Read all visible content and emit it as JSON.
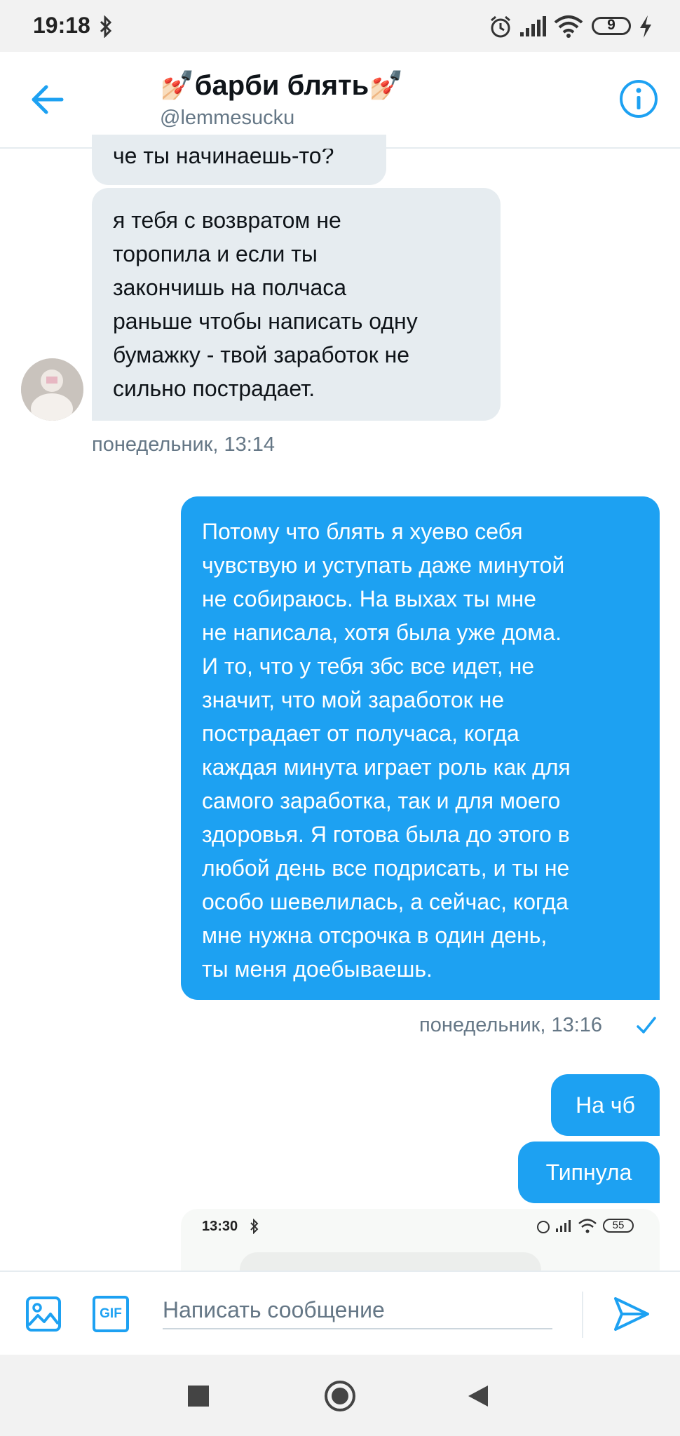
{
  "status_bar": {
    "time": "19:18",
    "battery": "9"
  },
  "header": {
    "title": "💅🏻барби блять💅🏻",
    "handle": "@lemmesucku"
  },
  "messages": [
    {
      "direction": "in",
      "text": "че ты начинаешь-то?"
    },
    {
      "direction": "in",
      "lines": [
        "я тебя с возвратом не",
        "торопила и если ты",
        "закончишь на полчаса",
        "раньше чтобы написать одну",
        "бумажку - твой заработок не",
        "сильно пострадает."
      ],
      "timestamp": "понедельник, 13:14"
    },
    {
      "direction": "out",
      "lines": [
        "Потому что блять я хуево себя",
        "чувствую и уступать даже минутой",
        "не собираюсь. На выхах ты мне",
        "не написала, хотя была уже дома.",
        "И то, что у тебя збс все идет, не",
        "значит, что мой заработок не",
        "пострадает от получаса, когда",
        "каждая минута играет роль как для",
        "самого заработка, так и для моего",
        "здоровья. Я готова была до этого в",
        "любой день все подрисать, и ты не",
        "особо шевелилась, а сейчас, когда",
        "мне нужна отсрочка в один день,",
        "ты меня доебываешь."
      ],
      "timestamp": "понедельник, 13:16"
    },
    {
      "direction": "out",
      "text": "На чб"
    },
    {
      "direction": "out",
      "text": "Типнула"
    }
  ],
  "attachment_preview": {
    "time": "13:30",
    "battery": "55"
  },
  "composer": {
    "placeholder": "Написать сообщение",
    "gif_label": "GIF"
  }
}
